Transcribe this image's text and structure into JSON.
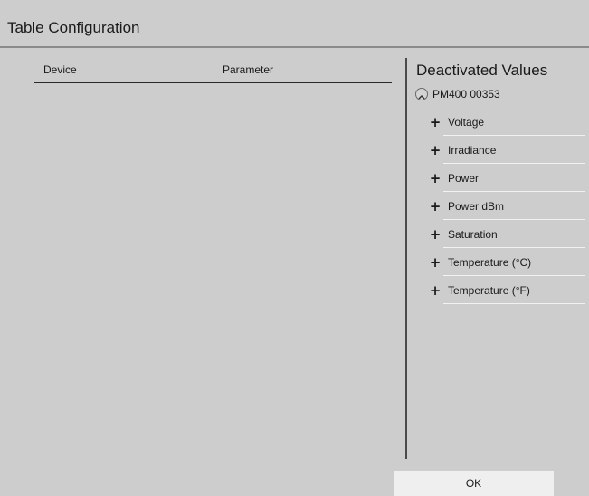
{
  "dialog": {
    "title": "Table Configuration"
  },
  "table": {
    "columns": [
      "Device",
      "Parameter"
    ],
    "rows": []
  },
  "deactivated": {
    "title": "Deactivated Values",
    "device": "PM400 00353",
    "items": [
      "Voltage",
      "Irradiance",
      "Power",
      "Power dBm",
      "Saturation",
      "Temperature (°C)",
      "Temperature (°F)"
    ]
  },
  "actions": {
    "ok_label": "OK"
  }
}
